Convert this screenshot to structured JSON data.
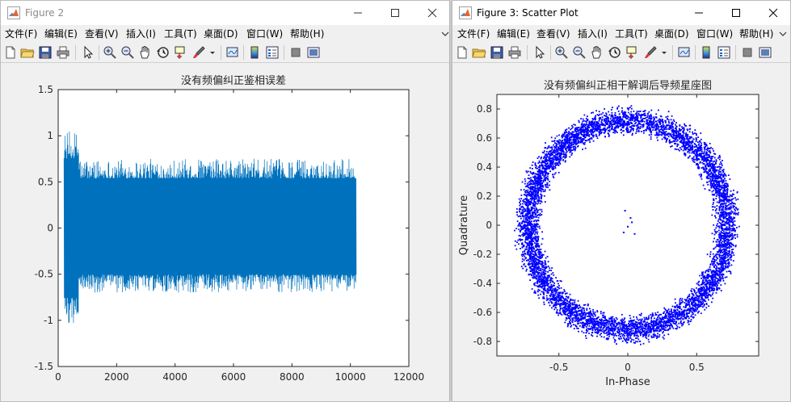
{
  "figure2": {
    "title": "Figure 2",
    "menu": [
      "文件(F)",
      "编辑(E)",
      "查看(V)",
      "插入(I)",
      "工具(T)",
      "桌面(D)",
      "窗口(W)",
      "帮助(H)"
    ],
    "chart_data": {
      "type": "line",
      "title": "没有频偏纠正鉴相误差",
      "xlim": [
        0,
        12000
      ],
      "ylim": [
        -1.5,
        1.5
      ],
      "xticks": [
        "0",
        "2000",
        "4000",
        "6000",
        "8000",
        "10000",
        "12000"
      ],
      "yticks": [
        "-1.5",
        "-1",
        "-0.5",
        "0",
        "0.5",
        "1",
        "1.5"
      ],
      "color": "#0072bd",
      "series": [
        {
          "x_range": [
            200,
            700
          ],
          "envelope": [
            -1.05,
            1.05
          ]
        },
        {
          "x_range": [
            700,
            10200
          ],
          "envelope": [
            -0.7,
            0.75
          ]
        }
      ]
    }
  },
  "figure3": {
    "title": "Figure 3: Scatter Plot",
    "menu": [
      "文件(F)",
      "编辑(E)",
      "查看(V)",
      "插入(I)",
      "工具(T)",
      "桌面(D)",
      "窗口(W)",
      "帮助(H)"
    ],
    "chart_data": {
      "type": "scatter",
      "title": "没有频偏纠正相干解调后导频星座图",
      "xlabel": "In-Phase",
      "ylabel": "Quadrature",
      "xlim": [
        -0.95,
        0.95
      ],
      "ylim": [
        -0.9,
        0.9
      ],
      "xticks": [
        "-0.5",
        "0",
        "0.5"
      ],
      "yticks": [
        "-0.8",
        "-0.6",
        "-0.4",
        "-0.2",
        "0",
        "0.2",
        "0.4",
        "0.6",
        "0.8"
      ],
      "color": "#0000ff",
      "ring_radius_range": [
        0.6,
        0.84
      ],
      "center_points": [
        [
          -0.02,
          0.1
        ],
        [
          0.02,
          0.05
        ],
        [
          0.03,
          0.02
        ],
        [
          0.0,
          -0.01
        ],
        [
          -0.03,
          -0.05
        ],
        [
          0.05,
          -0.06
        ]
      ]
    }
  }
}
